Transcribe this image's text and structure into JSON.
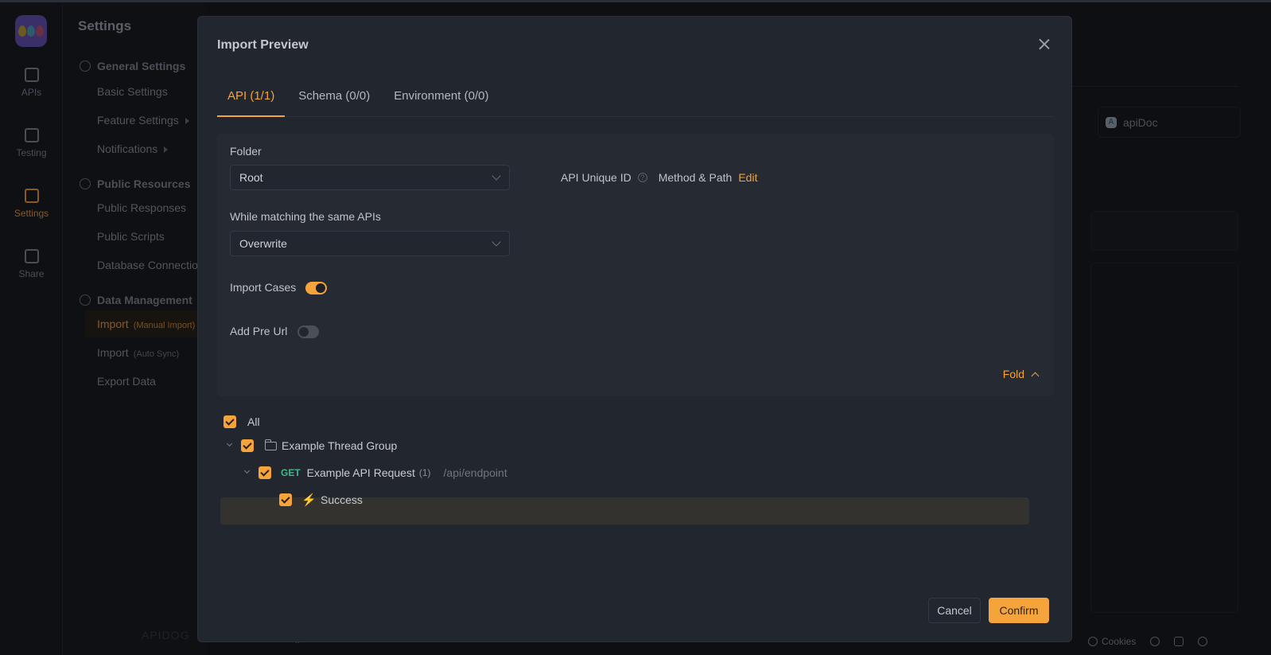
{
  "rail": {
    "items": [
      {
        "label": "APIs",
        "icon": "api-icon"
      },
      {
        "label": "Testing",
        "icon": "testing-icon"
      },
      {
        "label": "Settings",
        "icon": "settings-icon",
        "active": true
      },
      {
        "label": "Share",
        "icon": "share-icon"
      }
    ]
  },
  "settings_nav": {
    "title": "Settings",
    "groups": [
      {
        "label": "General Settings",
        "items": [
          "Basic Settings",
          "Feature Settings",
          "Notifications"
        ]
      },
      {
        "label": "Public Resources",
        "items": [
          "Public Responses",
          "Public Scripts",
          "Database Connections"
        ]
      },
      {
        "label": "Data Management",
        "items": [
          {
            "label": "Import",
            "sub": "(Manual Import)",
            "active": true
          },
          {
            "label": "Import",
            "sub": "(Auto Sync)"
          },
          {
            "label": "Export Data"
          }
        ]
      }
    ],
    "brand": "APIDOG"
  },
  "background": {
    "apidoc_label": "apiDoc",
    "footer": {
      "cookies": "Cookies"
    }
  },
  "modal": {
    "title": "Import Preview",
    "tabs": [
      {
        "label": "API (1/1)",
        "active": true
      },
      {
        "label": "Schema (0/0)"
      },
      {
        "label": "Environment (0/0)"
      }
    ],
    "folder": {
      "label": "Folder",
      "value": "Root"
    },
    "matching": {
      "label": "While matching the same APIs",
      "value": "Overwrite"
    },
    "unique_id": {
      "label": "API Unique ID",
      "value": "Method & Path",
      "edit": "Edit"
    },
    "import_cases": {
      "label": "Import Cases",
      "on": true
    },
    "add_pre_url": {
      "label": "Add Pre Url",
      "on": false
    },
    "fold_label": "Fold",
    "tree": {
      "all": "All",
      "group": "Example Thread Group",
      "api": {
        "method": "GET",
        "name": "Example API Request",
        "count": "(1)",
        "path": "/api/endpoint"
      },
      "case": "Success"
    },
    "cancel": "Cancel",
    "confirm": "Confirm"
  },
  "colors": {
    "accent": "#f5a33b",
    "get_method": "#3fb98a",
    "case_icon": "#8f6bd8"
  }
}
